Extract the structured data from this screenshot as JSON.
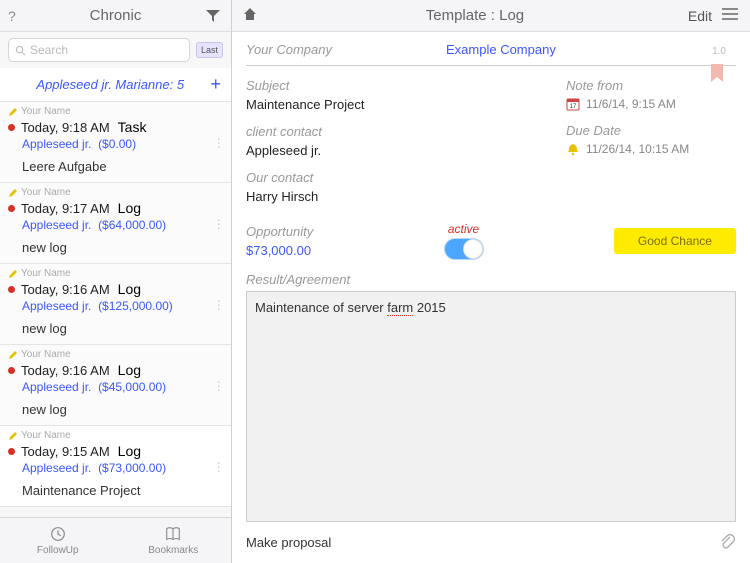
{
  "sidebar": {
    "help": "?",
    "title": "Chronic",
    "search_placeholder": "Search",
    "last_label": "Last",
    "group_label": "Appleseed jr. Marianne: 5",
    "items": [
      {
        "owner": "Your Name",
        "time": "Today, 9:18 AM",
        "type": "Task",
        "client": "Appleseed jr.",
        "amount": "($0.00)",
        "desc": "Leere Aufgabe"
      },
      {
        "owner": "Your Name",
        "time": "Today, 9:17 AM",
        "type": "Log",
        "client": "Appleseed jr.",
        "amount": "($64,000.00)",
        "desc": "new log"
      },
      {
        "owner": "Your Name",
        "time": "Today, 9:16 AM",
        "type": "Log",
        "client": "Appleseed jr.",
        "amount": "($125,000.00)",
        "desc": "new log"
      },
      {
        "owner": "Your Name",
        "time": "Today, 9:16 AM",
        "type": "Log",
        "client": "Appleseed jr.",
        "amount": "($45,000.00)",
        "desc": "new log"
      },
      {
        "owner": "Your Name",
        "time": "Today, 9:15 AM",
        "type": "Log",
        "client": "Appleseed jr.",
        "amount": "($73,000.00)",
        "desc": "Maintenance Project"
      }
    ],
    "footer": {
      "followup": "FollowUp",
      "bookmarks": "Bookmarks"
    }
  },
  "detail": {
    "title": "Template : Log",
    "edit": "Edit",
    "company_label": "Your Company",
    "company_value": "Example Company",
    "version": "1.0",
    "subject_label": "Subject",
    "subject_value": "Maintenance Project",
    "notefrom_label": "Note from",
    "notefrom_value": "11/6/14, 9:15 AM",
    "contact_label": "client contact",
    "contact_value": "Appleseed jr.",
    "due_label": "Due Date",
    "due_value": "11/26/14, 10:15 AM",
    "ourcontact_label": "Our contact",
    "ourcontact_value": "Harry Hirsch",
    "opportunity_label": "Opportunity",
    "opportunity_value": "$73,000.00",
    "active_label": "active",
    "chance_label": "Good Chance",
    "result_label": "Result/Agreement",
    "result_text_prefix": "Maintenance of server ",
    "result_text_underline": "farm",
    "result_text_suffix": " 2015",
    "footer_action": "Make proposal"
  }
}
